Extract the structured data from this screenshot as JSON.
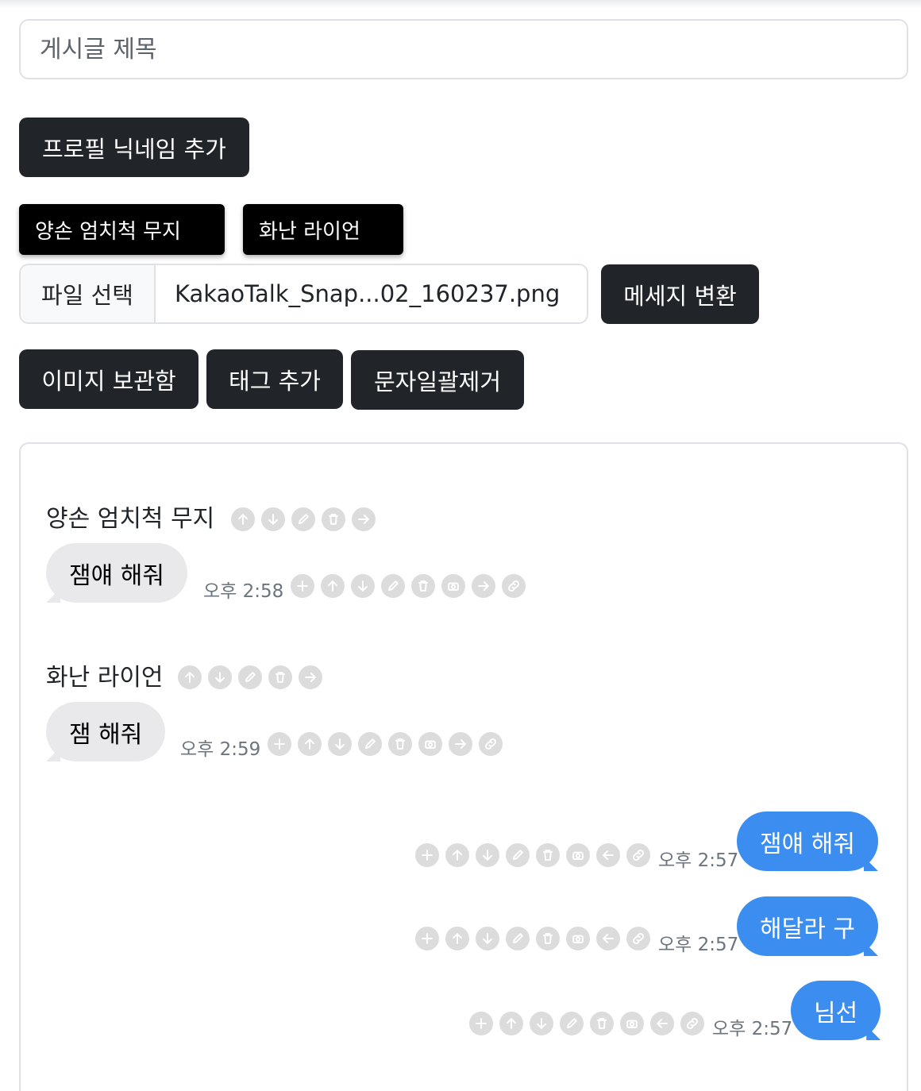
{
  "form": {
    "title_placeholder": "게시글 제목",
    "add_profile_button": "프로필 닉네임 추가",
    "speakers": [
      "양손 엄치척 무지",
      "화난 라이언"
    ],
    "file_choose_label": "파일 선택",
    "file_name": "KakaoTalk_Snap...02_160237.png",
    "convert_button": "메세지 변환",
    "image_storage_button": "이미지 보관함",
    "add_tag_button": "태그 추가",
    "bulk_remove_button": "문자일괄제거"
  },
  "chat": {
    "groups": [
      {
        "speaker": "양손 엄치척 무지",
        "message": "잼얘 해줘",
        "time": "오후 2:58"
      },
      {
        "speaker": "화난 라이언",
        "message": "잼 해줘",
        "time": "오후 2:59"
      }
    ],
    "outgoing": [
      {
        "message": "잼얘 해줘",
        "time": "오후 2:57"
      },
      {
        "message": "해달라 구",
        "time": "오후 2:57"
      },
      {
        "message": "님선",
        "time": "오후 2:57"
      }
    ]
  },
  "icons": {
    "speaker_actions": [
      "arrow-up-icon",
      "arrow-down-icon",
      "pencil-icon",
      "trash-icon",
      "arrow-right-icon"
    ],
    "incoming_actions": [
      "plus-icon",
      "arrow-up-icon",
      "arrow-down-icon",
      "pencil-icon",
      "trash-icon",
      "camera-icon",
      "arrow-right-icon",
      "link-icon"
    ],
    "outgoing_actions": [
      "plus-icon",
      "arrow-up-icon",
      "arrow-down-icon",
      "pencil-icon",
      "trash-icon",
      "camera-icon",
      "arrow-left-icon",
      "link-icon"
    ],
    "color": "#dcdcdc"
  },
  "colors": {
    "dark_button": "#212529",
    "speaker_button": "#000000",
    "incoming_bubble": "#e9e9eb",
    "outgoing_bubble": "#3c8df0"
  }
}
